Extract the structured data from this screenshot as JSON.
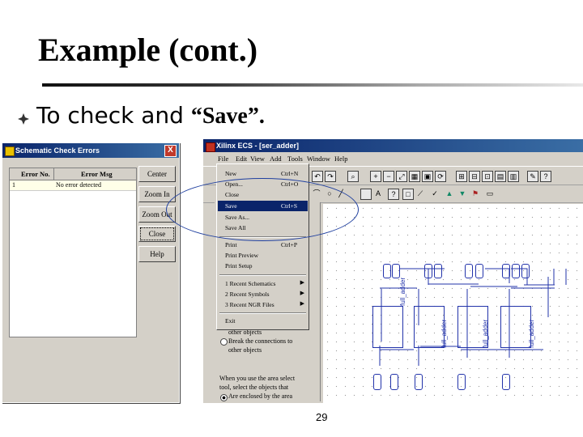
{
  "slide": {
    "title": "Example (cont.)",
    "bullet_text": "To check and ",
    "bullet_emph": "“Save”.",
    "page_number": "29"
  },
  "check_errors_dialog": {
    "title": "Schematic Check Errors",
    "close_glyph": "X",
    "columns": [
      "Error No.",
      "Error Msg"
    ],
    "rows": [
      {
        "no": "1",
        "msg": "No error detected"
      }
    ],
    "buttons": [
      "Center",
      "Zoom In",
      "Zoom Out",
      "Close",
      "Help"
    ]
  },
  "ecs_window": {
    "title": "Xilinx ECS - [ser_adder]",
    "menus": [
      "File",
      "Edit",
      "View",
      "Add",
      "Tools",
      "Window",
      "Help"
    ],
    "options": {
      "radio1_label": "other objects",
      "radio2_line1": "Break the connections to",
      "radio2_line2": "other objects",
      "note_line1": "When you use the area select",
      "note_line2": "tool, select the objects that",
      "radio3_label": "Are enclosed by the area"
    },
    "symbol_label": "full_adder"
  },
  "file_menu": {
    "items": [
      {
        "label": "New",
        "shortcut": "Ctrl+N"
      },
      {
        "label": "Open...",
        "shortcut": "Ctrl+O"
      },
      {
        "label": "Close",
        "shortcut": ""
      },
      {
        "label": "Save",
        "shortcut": "Ctrl+S"
      },
      {
        "label": "Save As...",
        "shortcut": ""
      },
      {
        "label": "Save All",
        "shortcut": ""
      },
      {
        "label": "Print",
        "shortcut": "Ctrl+P"
      },
      {
        "label": "Print Preview",
        "shortcut": ""
      },
      {
        "label": "Print Setup",
        "shortcut": ""
      },
      {
        "label": "1 Recent Schematics",
        "shortcut": ""
      },
      {
        "label": "2 Recent Symbols",
        "shortcut": ""
      },
      {
        "label": "3 Recent NGR Files",
        "shortcut": ""
      },
      {
        "label": "Exit",
        "shortcut": ""
      }
    ],
    "highlighted": "Save"
  },
  "colors": {
    "menu_highlight": "#0a246a",
    "ellipse": "#1f3f9f",
    "wire": "#2233aa",
    "titlebar": "#0a246a"
  }
}
